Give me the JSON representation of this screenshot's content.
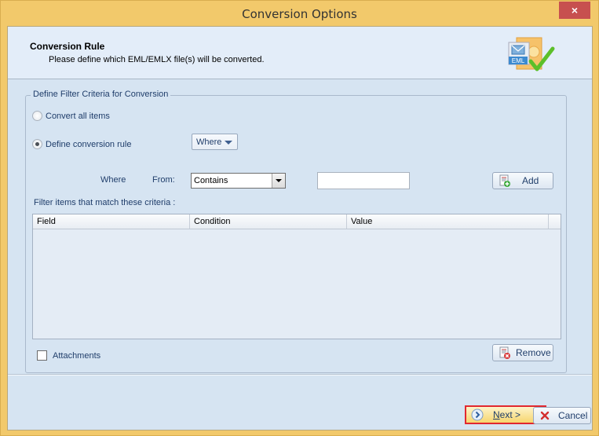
{
  "window": {
    "title": "Conversion Options",
    "close_label": "×"
  },
  "header": {
    "title": "Conversion Rule",
    "subtitle": "Please define which EML/EMLX file(s) will be converted.",
    "icon_badge": "EML"
  },
  "filter_group": {
    "label": "Define Filter Criteria for Conversion",
    "radio_all": {
      "label": "Convert all items",
      "checked": false
    },
    "radio_rule": {
      "label": "Define conversion rule",
      "checked": true
    },
    "where_dropdown": {
      "value": "Where"
    },
    "where_label": "Where",
    "from_label": "From:",
    "condition_combo": {
      "value": "Contains"
    },
    "value_input": {
      "value": "",
      "placeholder": ""
    },
    "add_button": "Add",
    "filter_items_label": "Filter items that match these criteria :",
    "grid": {
      "columns": [
        "Field",
        "Condition",
        "Value"
      ],
      "rows": []
    },
    "attachments_checkbox": {
      "label": "Attachments",
      "checked": false
    },
    "remove_button": "Remove"
  },
  "footer": {
    "next_button": "Next >",
    "next_mnemonic": "N",
    "next_rest": "ext >",
    "cancel_button": "Cancel"
  },
  "colors": {
    "frame": "#f2c96b",
    "client_bg": "#d6e4f2",
    "header_bg": "#e3edf9",
    "close_red": "#c7504f",
    "next_highlight": "#e12830",
    "label_blue": "#1f3d6a"
  }
}
